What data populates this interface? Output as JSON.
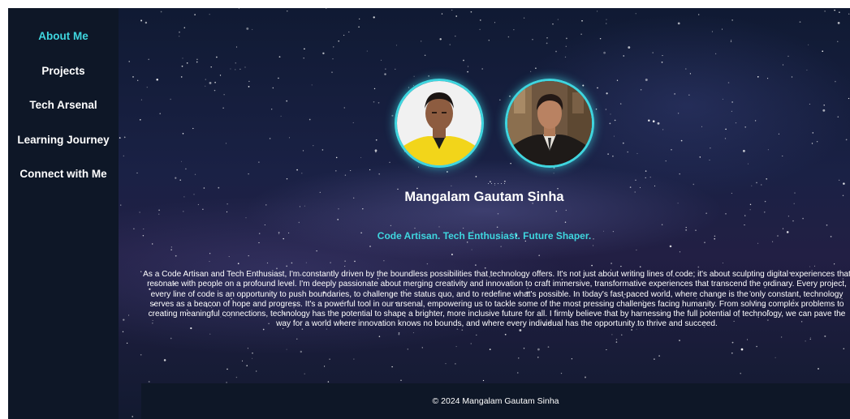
{
  "sidebar": {
    "items": [
      {
        "label": "About Me",
        "active": true
      },
      {
        "label": "Projects",
        "active": false
      },
      {
        "label": "Tech Arsenal",
        "active": false
      },
      {
        "label": "Learning Journey",
        "active": false
      },
      {
        "label": "Connect with Me",
        "active": false
      }
    ]
  },
  "hero": {
    "name": "Mangalam Gautam Sinha",
    "tagline": "Code Artisan. Tech Enthusiast. Future Shaper.",
    "bio": "As a Code Artisan and Tech Enthusiast, I'm constantly driven by the boundless possibilities that technology offers. It's not just about writing lines of code; it's about sculpting digital experiences that resonate with people on a profound level. I'm deeply passionate about merging creativity and innovation to craft immersive, transformative experiences that transcend the ordinary. Every project, every line of code is an opportunity to push boundaries, to challenge the status quo, and to redefine what's possible. In today's fast-paced world, where change is the only constant, technology serves as a beacon of hope and progress. It's a powerful tool in our arsenal, empowering us to tackle some of the most pressing challenges facing humanity. From solving complex problems to creating meaningful connections, technology has the potential to shape a brighter, more inclusive future for all. I firmly believe that by harnessing the full potential of technology, we can pave the way for a world where innovation knows no bounds, and where every individual has the opportunity to thrive and succeed."
  },
  "footer": {
    "text": "© 2024 Mangalam Gautam Sinha"
  },
  "colors": {
    "accent": "#3fd6df",
    "sidebar_bg": "#0e1727",
    "text": "#ffffff"
  }
}
